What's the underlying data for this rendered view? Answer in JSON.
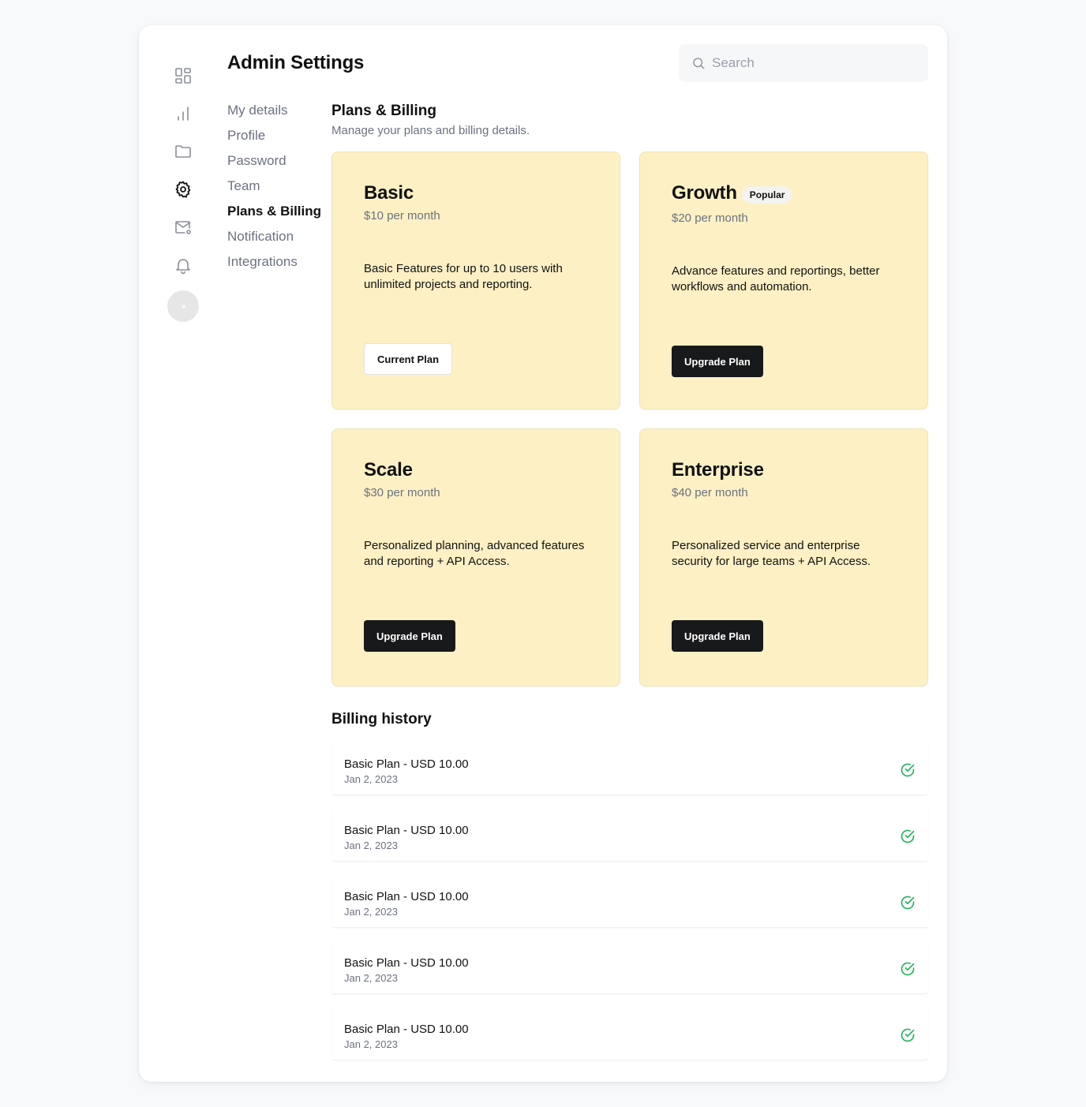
{
  "header": {
    "title": "Admin Settings"
  },
  "search": {
    "placeholder": "Search",
    "icon": "search-icon"
  },
  "rail": {
    "items": [
      {
        "icon": "dashboard-icon"
      },
      {
        "icon": "analytics-icon"
      },
      {
        "icon": "folder-icon"
      },
      {
        "icon": "settings-icon",
        "active": true
      },
      {
        "icon": "mail-icon"
      },
      {
        "icon": "bell-icon"
      }
    ]
  },
  "subnav": {
    "items": [
      {
        "label": "My details"
      },
      {
        "label": "Profile"
      },
      {
        "label": "Password"
      },
      {
        "label": "Team"
      },
      {
        "label": "Plans & Billing",
        "active": true
      },
      {
        "label": "Notification"
      },
      {
        "label": "Integrations"
      }
    ]
  },
  "section": {
    "title": "Plans & Billing",
    "subtitle": "Manage your plans and billing details."
  },
  "plans": [
    {
      "name": "Basic",
      "price": "$10 per month",
      "description": "Basic Features for up to 10 users with unlimited projects and reporting.",
      "button": "Current Plan"
    },
    {
      "name": "Growth",
      "badge": "Popular",
      "price": "$20 per month",
      "description": "Advance features and reportings, better workflows and automation.",
      "button": "Upgrade Plan"
    },
    {
      "name": "Scale",
      "price": "$30 per month",
      "description": "Personalized planning, advanced features and reporting + API Access.",
      "button": "Upgrade Plan"
    },
    {
      "name": "Enterprise",
      "price": "$40 per month",
      "description": "Personalized service and enterprise security for large teams + API Access.",
      "button": "Upgrade Plan"
    }
  ],
  "billing": {
    "title": "Billing history",
    "rows": [
      {
        "name": "Basic Plan - USD 10.00",
        "date": "Jan 2, 2023",
        "status_icon": "check-circle-icon"
      },
      {
        "name": "Basic Plan - USD 10.00",
        "date": "Jan 2, 2023",
        "status_icon": "check-circle-icon"
      },
      {
        "name": "Basic Plan - USD 10.00",
        "date": "Jan 2, 2023",
        "status_icon": "check-circle-icon"
      },
      {
        "name": "Basic Plan - USD 10.00",
        "date": "Jan 2, 2023",
        "status_icon": "check-circle-icon"
      },
      {
        "name": "Basic Plan - USD 10.00",
        "date": "Jan 2, 2023",
        "status_icon": "check-circle-icon"
      }
    ]
  },
  "colors": {
    "plan_card_bg": "#fdf0c4",
    "primary_button": "#18191b",
    "success": "#22b55c",
    "muted_text": "#6b7280"
  }
}
